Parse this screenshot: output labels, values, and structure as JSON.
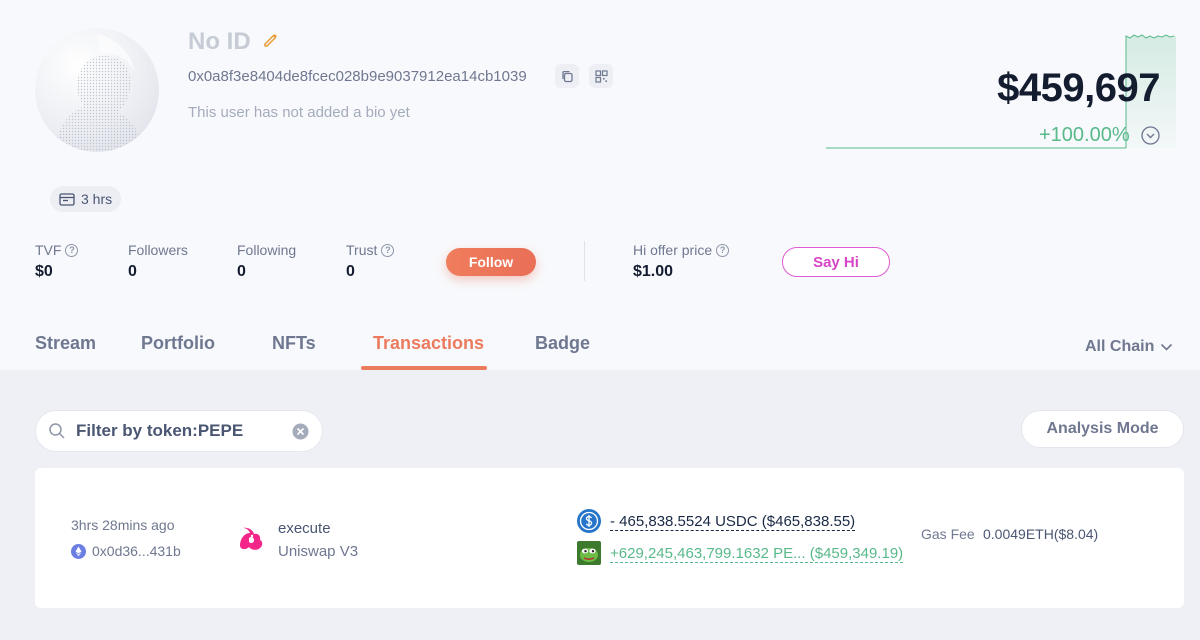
{
  "profile": {
    "name": "No ID",
    "address": "0x0a8f3e8404de8fcec028b9e9037912ea14cb1039",
    "bio": "This user has not added a bio yet",
    "active_time": "3 hrs",
    "avatar_icon": "user-avatar-placeholder",
    "edit_icon": "pencil-icon"
  },
  "portfolio": {
    "balance": "$459,697",
    "change": "+100.00%",
    "change_color": "#58b98a"
  },
  "stats": {
    "tvf": {
      "label": "TVF",
      "value": "$0"
    },
    "followers": {
      "label": "Followers",
      "value": "0"
    },
    "following": {
      "label": "Following",
      "value": "0"
    },
    "trust": {
      "label": "Trust",
      "value": "0"
    },
    "hi_offer": {
      "label": "Hi offer price",
      "value": "$1.00"
    }
  },
  "buttons": {
    "follow": "Follow",
    "say_hi": "Say Hi",
    "analysis_mode": "Analysis Mode"
  },
  "tabs": [
    {
      "label": "Stream",
      "active": false
    },
    {
      "label": "Portfolio",
      "active": false
    },
    {
      "label": "NFTs",
      "active": false
    },
    {
      "label": "Transactions",
      "active": true
    },
    {
      "label": "Badge",
      "active": false
    }
  ],
  "chain_filter": {
    "selected": "All Chain"
  },
  "search": {
    "value": "Filter by token:PEPE"
  },
  "transaction": {
    "time": "3hrs 28mins ago",
    "hash": "0x0d36...431b",
    "method": "execute",
    "protocol": "Uniswap V3",
    "amount_out": "- 465,838.5524 USDC ($465,838.55)",
    "amount_in": "+629,245,463,799.1632 PE... ($459,349.19)",
    "gas_label": "Gas Fee",
    "gas_value": "0.0049ETH($8.04)"
  },
  "colors": {
    "accent": "#ec7b5e",
    "positive": "#58b98a",
    "say_hi": "#d645c8"
  }
}
